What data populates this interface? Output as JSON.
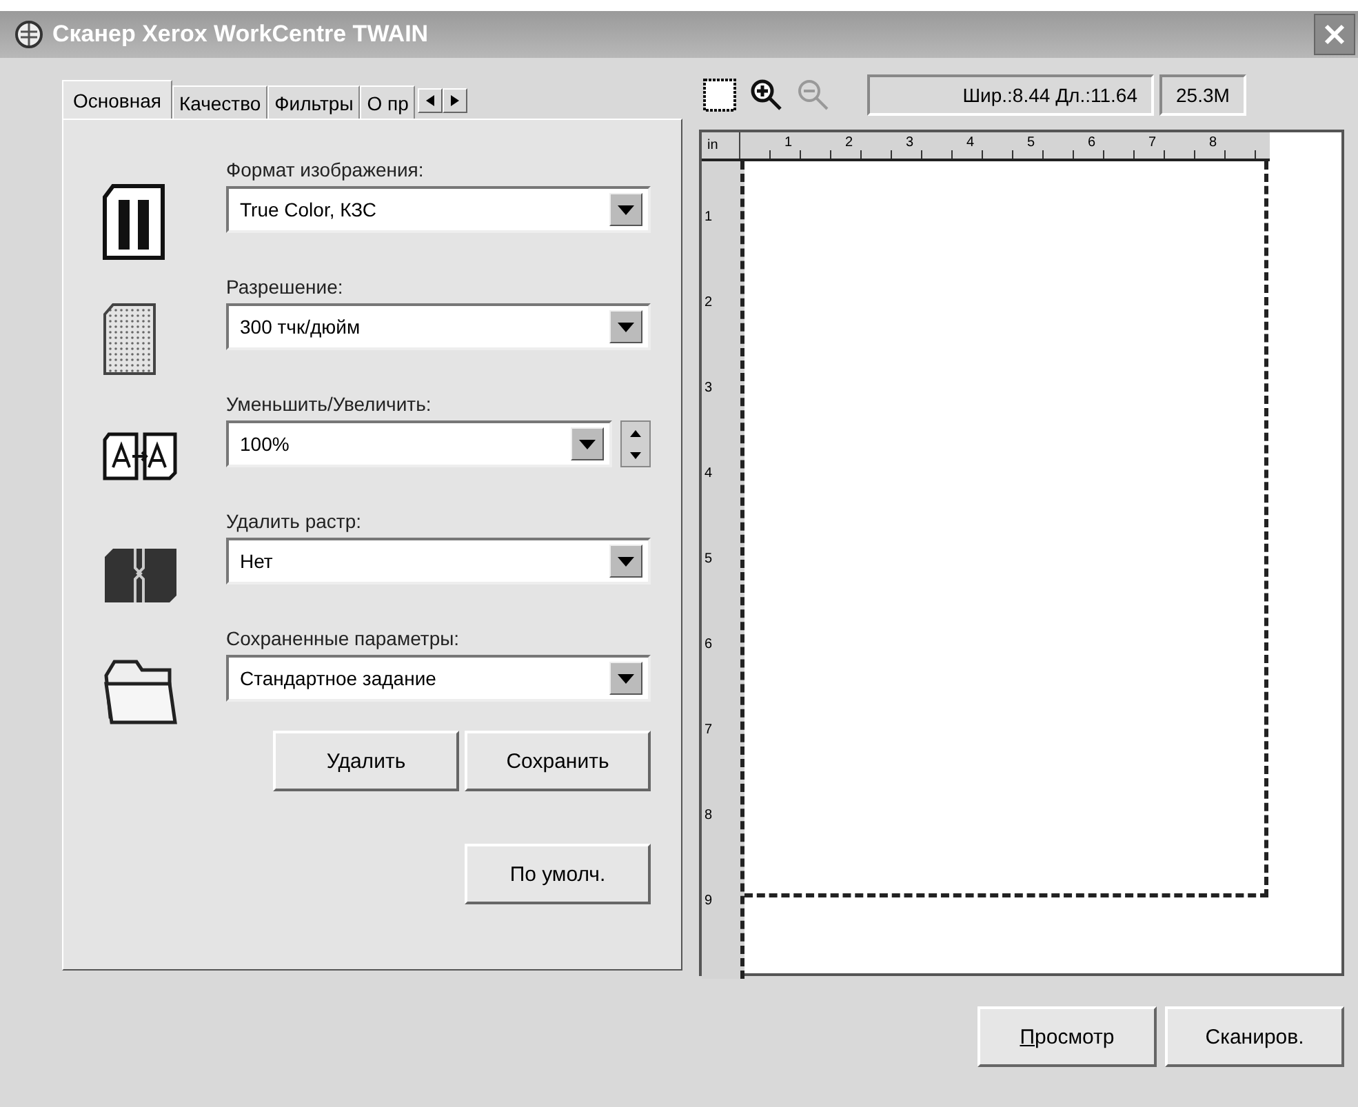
{
  "window": {
    "title": "Сканер Xerox WorkCentre TWAIN"
  },
  "tabs": [
    {
      "label": "Основная",
      "selected": true
    },
    {
      "label": "Качество",
      "selected": false
    },
    {
      "label": "Фильтры",
      "selected": false
    },
    {
      "label": "О пр",
      "selected": false
    }
  ],
  "settings": [
    {
      "kind": "format",
      "label": "Формат изображения:",
      "value": "True Color, КЗС",
      "spinner": false
    },
    {
      "kind": "resolution",
      "label": "Разрешение:",
      "value": "300 тчк/дюйм",
      "spinner": false
    },
    {
      "kind": "scale",
      "label": "Уменьшить/Увеличить:",
      "value": "100%",
      "spinner": true
    },
    {
      "kind": "descreen",
      "label": "Удалить растр:",
      "value": "Нет",
      "spinner": false
    },
    {
      "kind": "saved",
      "label": "Сохраненные параметры:",
      "value": "Стандартное задание",
      "spinner": false
    }
  ],
  "preset_buttons": [
    "Удалить",
    "Сохранить"
  ],
  "defaults_button": "По умолч.",
  "toolbar": {
    "dimensions": "Шир.:8.44  Дл.:11.64",
    "size": "25.3M"
  },
  "ruler": {
    "unit": "in",
    "x_labels": [
      "1",
      "2",
      "3",
      "4",
      "5",
      "6",
      "7",
      "8"
    ],
    "y_labels": [
      "1",
      "2",
      "3",
      "4",
      "5",
      "6",
      "7",
      "8",
      "9"
    ]
  },
  "actions": [
    {
      "label": "Просмотр",
      "underline_first": true
    },
    {
      "label": "Сканиров.",
      "underline_first": false
    }
  ]
}
